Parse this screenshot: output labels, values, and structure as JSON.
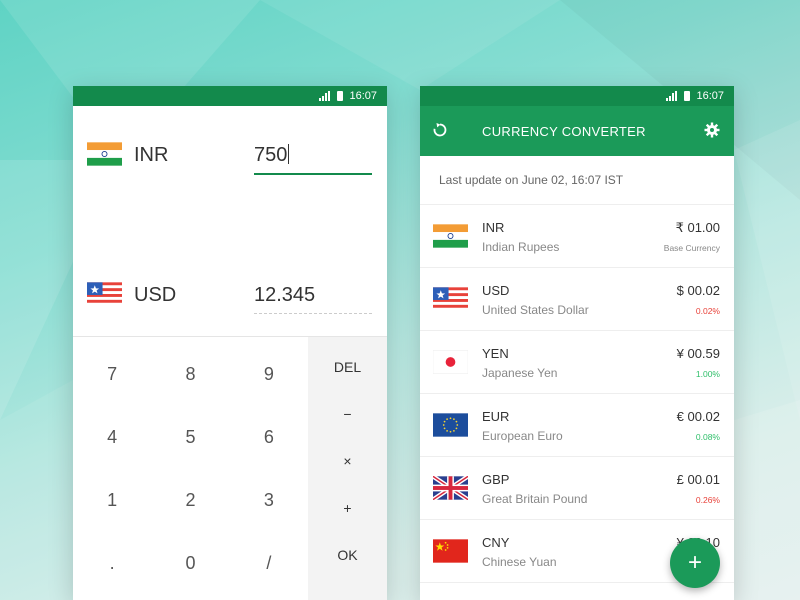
{
  "status": {
    "time": "16:07"
  },
  "converter": {
    "from": {
      "code": "INR",
      "amount": "750",
      "flag": "india-flag"
    },
    "to": {
      "code": "USD",
      "amount": "12.345",
      "flag": "usa-flag"
    }
  },
  "keypad": {
    "digits": [
      "7",
      "8",
      "9",
      "4",
      "5",
      "6",
      "1",
      "2",
      "3",
      ".",
      "0",
      "/"
    ],
    "ops": [
      "DEL",
      "−",
      "×",
      "+",
      "OK"
    ]
  },
  "app": {
    "title": "CURRENCY CONVERTER",
    "last_update": "Last update on June 02, 16:07 IST",
    "fab_label": "+"
  },
  "currencies": [
    {
      "code": "INR",
      "name": "Indian Rupees",
      "value": "₹ 01.00",
      "sub": "Base Currency",
      "sub_type": "neutral",
      "flag": "india-flag"
    },
    {
      "code": "USD",
      "name": "United States Dollar",
      "value": "$ 00.02",
      "sub": "0.02%",
      "sub_type": "down",
      "flag": "usa-flag"
    },
    {
      "code": "YEN",
      "name": "Japanese Yen",
      "value": "¥ 00.59",
      "sub": "1.00%",
      "sub_type": "up",
      "flag": "japan-flag"
    },
    {
      "code": "EUR",
      "name": "European Euro",
      "value": "€ 00.02",
      "sub": "0.08%",
      "sub_type": "up",
      "flag": "eu-flag"
    },
    {
      "code": "GBP",
      "name": "Great Britain Pound",
      "value": "£ 00.01",
      "sub": "0.26%",
      "sub_type": "down",
      "flag": "uk-flag"
    },
    {
      "code": "CNY",
      "name": "Chinese Yuan",
      "value": "¥ 00.10",
      "sub": "",
      "sub_type": "neutral",
      "flag": "china-flag"
    }
  ],
  "colors": {
    "primary": "#1b9a59",
    "status_bar": "#138a4c",
    "negative": "#e8423a",
    "positive": "#2fbf6a"
  }
}
